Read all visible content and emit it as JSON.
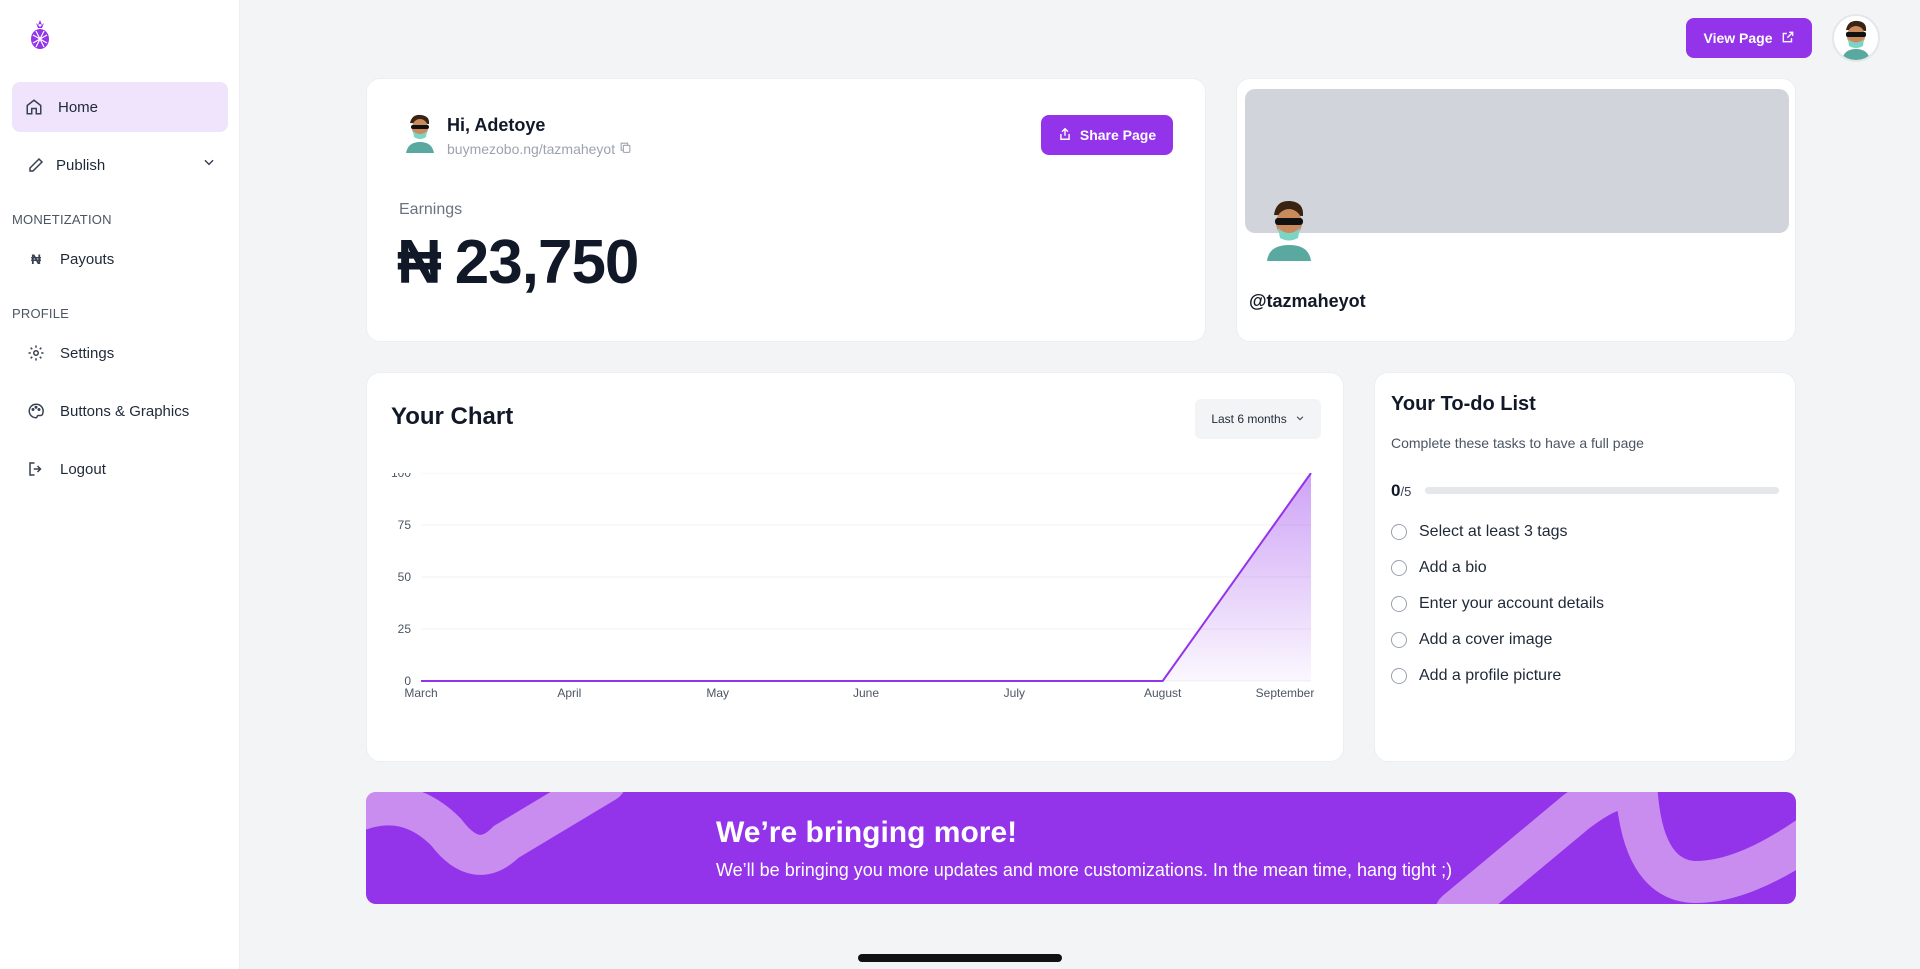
{
  "sidebar": {
    "items": [
      {
        "label": "Home",
        "icon": "home-icon"
      },
      {
        "label": "Publish",
        "icon": "pencil-icon"
      },
      {
        "label": "Payouts",
        "icon": "naira-icon"
      },
      {
        "label": "Settings",
        "icon": "gear-icon"
      },
      {
        "label": "Buttons & Graphics",
        "icon": "palette-icon"
      },
      {
        "label": "Logout",
        "icon": "logout-icon"
      }
    ],
    "sections": {
      "monetization": "MONETIZATION",
      "profile": "PROFILE"
    }
  },
  "header": {
    "view_page_label": "View Page"
  },
  "greeting": {
    "name": "Hi, Adetoye",
    "url": "buymezobo.ng/tazmaheyot",
    "share_label": "Share Page",
    "earnings_label": "Earnings",
    "currency": "₦",
    "earnings_value": "23,750"
  },
  "profile": {
    "handle": "@tazmaheyot"
  },
  "chart": {
    "title": "Your Chart",
    "range_label": "Last 6 months"
  },
  "chart_data": {
    "type": "area",
    "categories": [
      "March",
      "April",
      "May",
      "June",
      "July",
      "August",
      "September"
    ],
    "values": [
      0,
      0,
      0,
      0,
      0,
      0,
      100
    ],
    "ylim": [
      0,
      100
    ],
    "yticks": [
      0,
      25,
      50,
      75,
      100
    ],
    "grid": true,
    "color": "#9333ea"
  },
  "todo": {
    "title": "Your To-do List",
    "subtitle": "Complete these tasks to have a full page",
    "done": "0",
    "total": "/5",
    "progress": 0,
    "items": [
      "Select at least 3 tags",
      "Add a bio",
      "Enter your account details",
      "Add a cover image",
      "Add a profile picture"
    ]
  },
  "banner": {
    "title": "We’re bringing more!",
    "text": "We’ll be bringing you more updates and more customizations. In the mean time, hang tight ;)"
  },
  "colors": {
    "accent": "#9333ea",
    "accent_light": "#efe4fb",
    "banner_wave": "#c98df0"
  }
}
